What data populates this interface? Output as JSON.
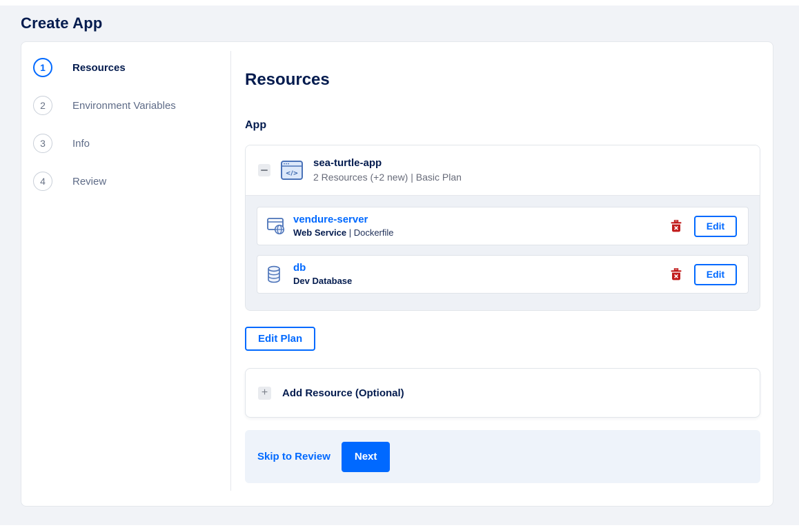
{
  "page": {
    "title": "Create App"
  },
  "colors": {
    "accent": "#0069ff",
    "navy": "#031b4e",
    "muted_gray": "#676b79",
    "danger_red": "#c11c1c",
    "footer_bg": "#eef3fa",
    "group_body_bg": "#eef1f6",
    "page_bg": "#f1f3f7"
  },
  "stepper": {
    "steps": [
      {
        "number": "1",
        "label": "Resources"
      },
      {
        "number": "2",
        "label": "Environment Variables"
      },
      {
        "number": "3",
        "label": "Info"
      },
      {
        "number": "4",
        "label": "Review"
      }
    ],
    "active_step": 1
  },
  "main": {
    "heading": "Resources",
    "section_label": "App",
    "app_group": {
      "name": "sea-turtle-app",
      "summary": "2 Resources (+2 new) | Basic Plan",
      "resources": [
        {
          "name": "vendure-server",
          "subtitle_bold": "Web Service",
          "subtitle_rest": " | Dockerfile",
          "icon": "web-service-icon",
          "edit_label": "Edit"
        },
        {
          "name": "db",
          "subtitle_bold": "Dev Database",
          "subtitle_rest": "",
          "icon": "database-icon",
          "edit_label": "Edit"
        }
      ]
    },
    "edit_plan_label": "Edit Plan",
    "add_resource_label": "Add Resource (Optional)",
    "footer": {
      "skip_label": "Skip to Review",
      "next_label": "Next"
    }
  }
}
